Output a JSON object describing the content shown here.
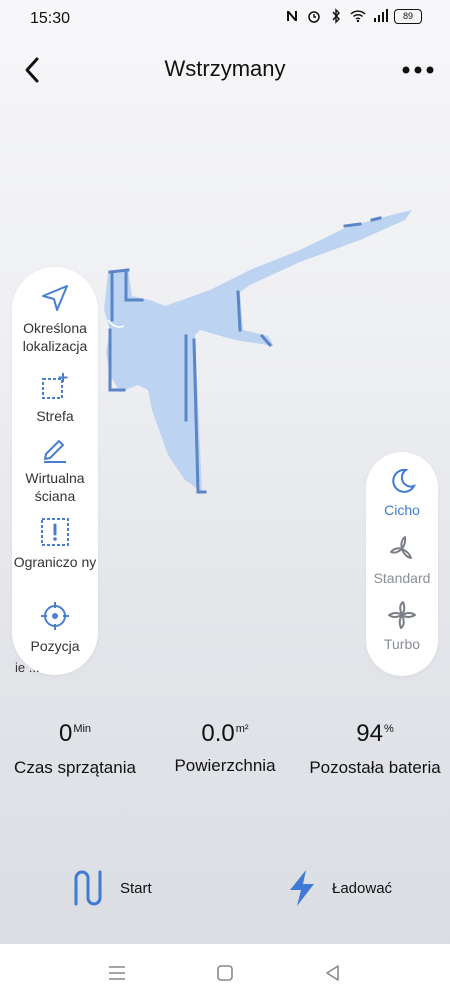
{
  "status_bar": {
    "time": "15:30",
    "battery": "89",
    "icons": [
      "nfc-icon",
      "alarm-icon",
      "bluetooth-icon",
      "wifi-icon",
      "signal-icon",
      "battery-icon"
    ]
  },
  "header": {
    "title": "Wstrzymany",
    "back_icon": "chevron-left-icon",
    "more_icon": "more-dots-icon"
  },
  "tools": [
    {
      "label": "Określona lokalizacja",
      "icon": "navigation-arrow-icon"
    },
    {
      "label": "Strefa",
      "icon": "zone-add-icon"
    },
    {
      "label": "Wirtualna ściana",
      "icon": "pen-icon"
    },
    {
      "label": "Ograniczo ny",
      "icon": "restricted-zone-icon"
    },
    {
      "label": "Pozycja",
      "icon": "crosshair-icon"
    }
  ],
  "tools_overflow_label": "ie ...",
  "modes": [
    {
      "label": "Cicho",
      "icon": "moon-icon",
      "active": true
    },
    {
      "label": "Standard",
      "icon": "fan-icon",
      "active": false
    },
    {
      "label": "Turbo",
      "icon": "turbo-fan-icon",
      "active": false
    }
  ],
  "stats": [
    {
      "value": "0",
      "unit": "Min",
      "label": "Czas sprzątania"
    },
    {
      "value": "0.0",
      "unit": "m²",
      "label": "Powierzchnia"
    },
    {
      "value": "94",
      "unit": "%",
      "label": "Pozostała bateria"
    }
  ],
  "actions": {
    "start": {
      "label": "Start",
      "icon": "start-path-icon"
    },
    "charge": {
      "label": "Ładować",
      "icon": "lightning-icon"
    }
  },
  "colors": {
    "accent": "#3f7ad6",
    "map_fill": "#bcd4f2",
    "map_wall": "#5a86c8",
    "inactive": "#8a8e97"
  }
}
